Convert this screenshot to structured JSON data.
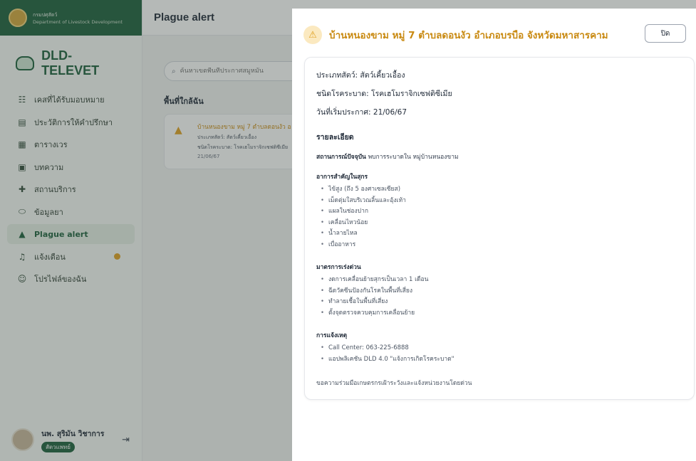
{
  "sidebar": {
    "dept_th": "กรมปศุสัตว์",
    "dept_en": "Department of Livestock Development",
    "brand": "DLD- TELEVET",
    "items": [
      {
        "label": "เคสที่ได้รับมอบหมาย",
        "icon": "cases-icon"
      },
      {
        "label": "ประวัติการให้คำปรึกษา",
        "icon": "history-icon"
      },
      {
        "label": "ตารางเวร",
        "icon": "calendar-icon"
      },
      {
        "label": "บทความ",
        "icon": "article-icon"
      },
      {
        "label": "สถานบริการ",
        "icon": "clinic-icon"
      },
      {
        "label": "ข้อมูลยา",
        "icon": "pill-icon"
      },
      {
        "label": "Plague alert",
        "icon": "warning-icon"
      },
      {
        "label": "แจ้งเตือน",
        "icon": "bell-icon"
      },
      {
        "label": "โปรไฟล์ของฉัน",
        "icon": "user-icon"
      }
    ],
    "user": {
      "name": "นพ. สุริมัน วิชาการ",
      "role": "สัตวแพทย์"
    }
  },
  "main": {
    "title": "Plague alert",
    "search_placeholder": "ค้นหาเขตพื้นที่ประกาศสมูหมัน",
    "section_title": "พื้นที่ใกล้ฉัน",
    "card": {
      "title": "บ้านหนองขาม หมู่ 7 ตำบลดอนงัว อ",
      "animal": "ประเภทสัตว์: สัตว์เคี้ยวเอื้อง",
      "disease": "ชนิดโรคระบาด: โรคเฮโมราจิกเซฟติซีเมีย",
      "date": "21/06/67"
    }
  },
  "drawer": {
    "title": "บ้านหนองขาม หมู่ 7 ตำบลดอนงัว อำเภอบรบือ จังหวัดมหาสารคาม",
    "close_label": "ปิด",
    "animal_type": "ประเภทสัตว์: สัตว์เคี้ยวเอื้อง",
    "disease_type": "ชนิดโรคระบาด: โรคเฮโมราจิกเซฟติซีเมีย",
    "announce_date": "วันที่เริ่มประกาศ: 21/06/67",
    "details_heading": "รายละเอียด",
    "situation_label": "สถานการณ์ปัจจุบัน",
    "situation_text": "พบการระบาดใน หมู่บ้านหนองขาม",
    "symptoms_heading": "อาการสำคัญในสุกร",
    "symptoms": [
      "ไข้สูง (ถึง 5 องศาเซลเซียส)",
      "เม็ดตุ่มใสบริเวณลิ้นและอุ้งเท้า",
      "แผลในช่องปาก",
      "เคลื่อนไหวน้อย",
      "น้ำลายไหล",
      "เบื่ออาหาร"
    ],
    "measures_heading": "มาตรการเร่งด่วน",
    "measures": [
      "งดการเคลื่อนย้ายสุกรเป็นเวลา 1 เดือน",
      "ฉีดวัคซีนป้องกันโรคในพื้นที่เสี่ยง",
      "ทำลายเชื้อในพื้นที่เสี่ยง",
      "ตั้งจุดตรวจควบคุมการเคลื่อนย้าย"
    ],
    "report_heading": "การแจ้งเหตุ",
    "report": [
      "Call Center: 063-225-6888",
      "แอปพลิเคชัน DLD 4.0 \"แจ้งการเกิดโรคระบาด\""
    ],
    "footer_note": "ขอความร่วมมือเกษตรกรเฝ้าระวังและแจ้งหน่วยงานโดยด่วน"
  },
  "colors": {
    "brand_green": "#1b5e3a",
    "warning_amber": "#e0a020",
    "title_amber": "#c98a12"
  }
}
